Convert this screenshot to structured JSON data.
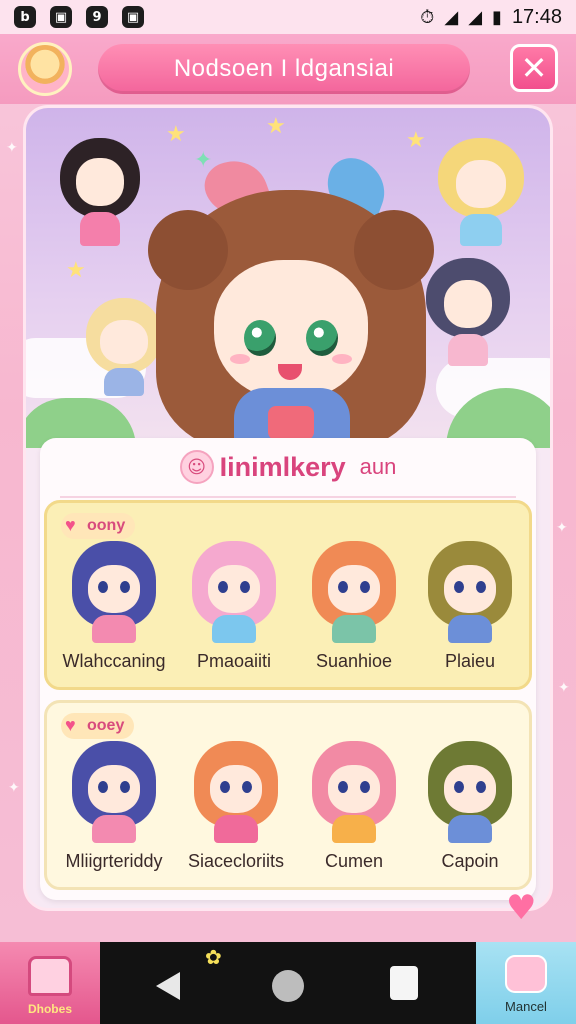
{
  "status_bar": {
    "left_icons": [
      "b",
      "▣",
      "9",
      "▣"
    ],
    "time": "17:48"
  },
  "header": {
    "title": "Nodsoen I ldgansiai",
    "close_label": "✕"
  },
  "panel": {
    "title": "Iinimlkery",
    "subtitle": "aun",
    "logo_icon": "☺"
  },
  "cards": [
    {
      "badge": "oony",
      "characters": [
        {
          "name": "Wlahccaning",
          "hair": "#4a4fa8",
          "outfit": "#f38ab0"
        },
        {
          "name": "Pmaoaiiti",
          "hair": "#f5a9cf",
          "outfit": "#7cc7ee"
        },
        {
          "name": "Suanhioe",
          "hair": "#f08a55",
          "outfit": "#7bc4a8"
        },
        {
          "name": "Plaieu",
          "hair": "#9a8a3b",
          "outfit": "#6c8fd8"
        }
      ]
    },
    {
      "badge": "ooey",
      "characters": [
        {
          "name": "Mliigrteriddy",
          "hair": "#4a4fa8",
          "outfit": "#f38ab0"
        },
        {
          "name": "Siacecloriits",
          "hair": "#f08a55",
          "outfit": "#f06a9a"
        },
        {
          "name": "Cumen",
          "hair": "#f28aa4",
          "outfit": "#f7b04a"
        },
        {
          "name": "Capoin",
          "hair": "#6e7a34",
          "outfit": "#6c8fd8"
        }
      ]
    }
  ],
  "nav": {
    "home_label": "Dhobes",
    "cancel_label": "Mancel"
  },
  "colors": {
    "accent": "#f3649b",
    "panel_title": "#d9447d",
    "card1_bg": "#fbefb6",
    "card2_bg": "#fff8df"
  }
}
